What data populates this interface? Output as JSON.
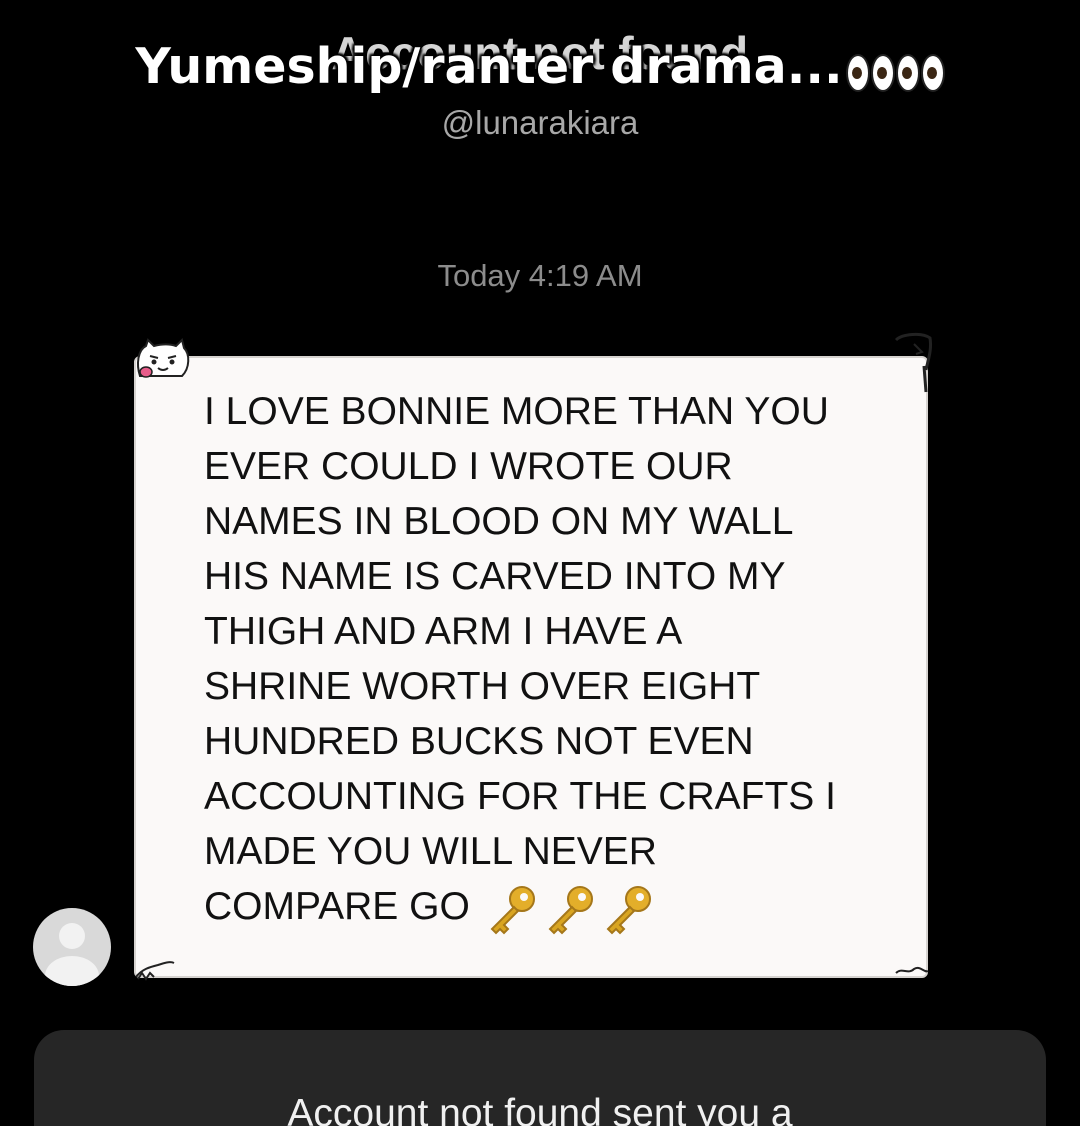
{
  "header": {
    "title": "Account not found",
    "handle": "@lunarakiara"
  },
  "overlay": {
    "caption": "Yumeship/ranter drama...",
    "emoji": "eyes-emoji"
  },
  "conversation": {
    "timestamp": "Today 4:19 AM",
    "message": {
      "text": "I LOVE BONNIE MORE THAN YOU\nEVER COULD I WROTE OUR\nNAMES IN BLOOD ON MY WALL\nHIS NAME IS CARVED INTO MY\nTHIGH AND ARM I HAVE A\nSHRINE WORTH OVER EIGHT\nHUNDRED BUCKS NOT EVEN\nACCOUNTING FOR THE CRAFTS I\nMADE YOU WILL NEVER\nCOMPARE GO",
      "emoji": "key-emoji"
    },
    "sender_avatar": "default-avatar-icon"
  },
  "notice": {
    "text": "Account not found sent you a"
  },
  "colors": {
    "background": "#000000",
    "bubble": "#fbf9f8",
    "notice_card": "#262626",
    "key_gold": "#d9a521"
  }
}
